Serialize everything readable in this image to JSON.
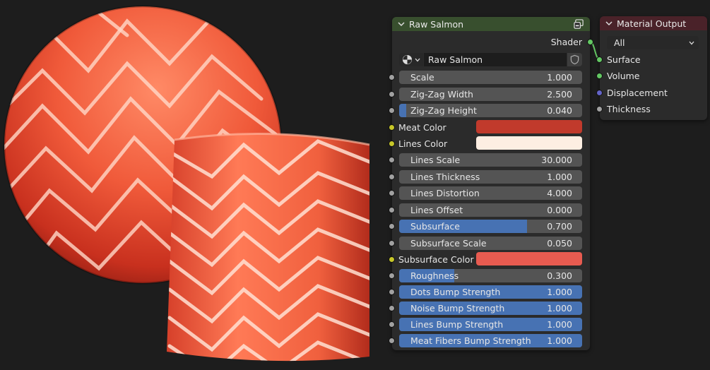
{
  "node": {
    "title": "Raw Salmon",
    "output_socket": "Shader",
    "datablock": "Raw Salmon",
    "inputs": [
      {
        "label": "Scale",
        "value": "1.000",
        "fill": 0
      },
      {
        "label": "Zig-Zag Width",
        "value": "2.500",
        "fill": 0
      },
      {
        "label": "Zig-Zag Height",
        "value": "0.040",
        "fill": 0.04
      }
    ],
    "meat_color": {
      "label": "Meat Color",
      "color": "#c13a2c"
    },
    "lines_color": {
      "label": "Lines Color",
      "color": "#fdeee2"
    },
    "inputs2": [
      {
        "label": "Lines Scale",
        "value": "30.000",
        "fill": 0
      },
      {
        "label": "Lines Thickness",
        "value": "1.000",
        "fill": 0
      },
      {
        "label": "Lines Distortion",
        "value": "4.000",
        "fill": 0
      },
      {
        "label": "Lines Offset",
        "value": "0.000",
        "fill": 0
      },
      {
        "label": "Subsurface",
        "value": "0.700",
        "fill": 0.7
      },
      {
        "label": "Subsurface Scale",
        "value": "0.050",
        "fill": 0
      }
    ],
    "subsurface_color": {
      "label": "Subsurface Color",
      "color": "#e85b50"
    },
    "inputs3": [
      {
        "label": "Roughness",
        "value": "0.300",
        "fill": 0.3
      },
      {
        "label": "Dots Bump Strength",
        "value": "1.000",
        "fill": 1
      },
      {
        "label": "Noise Bump Strength",
        "value": "1.000",
        "fill": 1
      },
      {
        "label": "Lines Bump Strength",
        "value": "1.000",
        "fill": 1
      },
      {
        "label": "Meat Fibers Bump Strength",
        "value": "1.000",
        "fill": 1
      }
    ]
  },
  "output_node": {
    "title": "Material Output",
    "target": "All",
    "inputs": [
      "Surface",
      "Volume",
      "Displacement",
      "Thickness"
    ]
  },
  "colors": {
    "field": "#545454",
    "fill": "#4772b3",
    "shader_socket": "#63c763",
    "color_socket": "#c7c729",
    "float_socket": "#a1a1a1",
    "vector_socket": "#6363c7"
  }
}
